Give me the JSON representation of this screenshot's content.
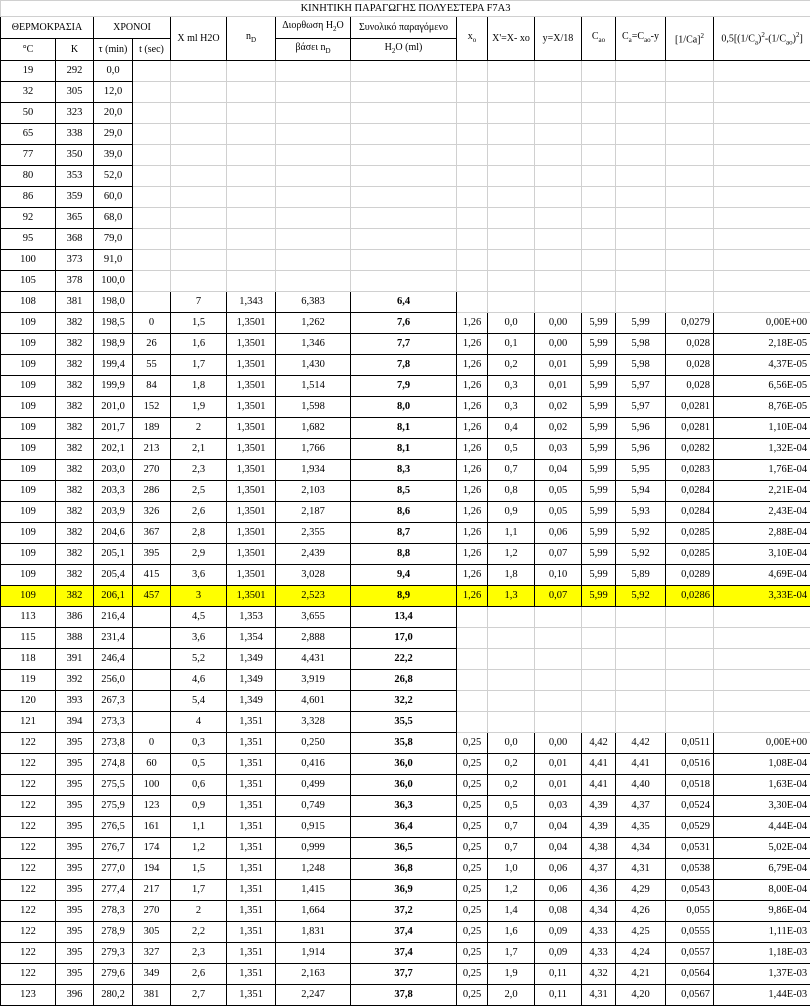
{
  "title": "ΚΙΝΗΤΙΚΗ ΠΑΡΑΓΩΓΗΣ ΠΟΛΥΕΣΤΕΡΑ F7A3",
  "header": {
    "temperature_group": "ΘΕΡΜΟΚΡΑΣΙΑ",
    "times_group": "ΧΡΟΝΟΙ",
    "celsius": "°C",
    "kelvin": "K",
    "t_min": "τ (min)",
    "t_sec": "t (sec)",
    "x_ml": "X ml H2O",
    "nd": "nD",
    "correction": "Διορθωση H2O βάσει nD",
    "total": "Συνολικό παραγόμενο H2O (ml)",
    "xo": "xo",
    "xprime": "X'=X- xo",
    "y": "y=X/18",
    "cao": "Cao",
    "ca": "Ca=Cao-y",
    "inv_ca2": "[1/Ca]²",
    "half_formula": "0,5[(1/Ca)²-(1/Cao)²]"
  },
  "rows": [
    [
      "19",
      "292",
      "0,0",
      "",
      "",
      "",
      "",
      "",
      "",
      "",
      "",
      "",
      "",
      "",
      ""
    ],
    [
      "32",
      "305",
      "12,0",
      "",
      "",
      "",
      "",
      "",
      "",
      "",
      "",
      "",
      "",
      "",
      ""
    ],
    [
      "50",
      "323",
      "20,0",
      "",
      "",
      "",
      "",
      "",
      "",
      "",
      "",
      "",
      "",
      "",
      ""
    ],
    [
      "65",
      "338",
      "29,0",
      "",
      "",
      "",
      "",
      "",
      "",
      "",
      "",
      "",
      "",
      "",
      ""
    ],
    [
      "77",
      "350",
      "39,0",
      "",
      "",
      "",
      "",
      "",
      "",
      "",
      "",
      "",
      "",
      "",
      ""
    ],
    [
      "80",
      "353",
      "52,0",
      "",
      "",
      "",
      "",
      "",
      "",
      "",
      "",
      "",
      "",
      "",
      ""
    ],
    [
      "86",
      "359",
      "60,0",
      "",
      "",
      "",
      "",
      "",
      "",
      "",
      "",
      "",
      "",
      "",
      ""
    ],
    [
      "92",
      "365",
      "68,0",
      "",
      "",
      "",
      "",
      "",
      "",
      "",
      "",
      "",
      "",
      "",
      ""
    ],
    [
      "95",
      "368",
      "79,0",
      "",
      "",
      "",
      "",
      "",
      "",
      "",
      "",
      "",
      "",
      "",
      ""
    ],
    [
      "100",
      "373",
      "91,0",
      "",
      "",
      "",
      "",
      "",
      "",
      "",
      "",
      "",
      "",
      "",
      ""
    ],
    [
      "105",
      "378",
      "100,0",
      "",
      "",
      "",
      "",
      "",
      "",
      "",
      "",
      "",
      "",
      "",
      ""
    ],
    [
      "108",
      "381",
      "198,0",
      "",
      "7",
      "1,343",
      "6,383",
      "6,4",
      "",
      "",
      "",
      "",
      "",
      "",
      ""
    ],
    [
      "109",
      "382",
      "198,5",
      "0",
      "1,5",
      "1,3501",
      "1,262",
      "7,6",
      "1,26",
      "0,0",
      "0,00",
      "5,99",
      "5,99",
      "0,0279",
      "0,00E+00"
    ],
    [
      "109",
      "382",
      "198,9",
      "26",
      "1,6",
      "1,3501",
      "1,346",
      "7,7",
      "1,26",
      "0,1",
      "0,00",
      "5,99",
      "5,98",
      "0,028",
      "2,18E-05"
    ],
    [
      "109",
      "382",
      "199,4",
      "55",
      "1,7",
      "1,3501",
      "1,430",
      "7,8",
      "1,26",
      "0,2",
      "0,01",
      "5,99",
      "5,98",
      "0,028",
      "4,37E-05"
    ],
    [
      "109",
      "382",
      "199,9",
      "84",
      "1,8",
      "1,3501",
      "1,514",
      "7,9",
      "1,26",
      "0,3",
      "0,01",
      "5,99",
      "5,97",
      "0,028",
      "6,56E-05"
    ],
    [
      "109",
      "382",
      "201,0",
      "152",
      "1,9",
      "1,3501",
      "1,598",
      "8,0",
      "1,26",
      "0,3",
      "0,02",
      "5,99",
      "5,97",
      "0,0281",
      "8,76E-05"
    ],
    [
      "109",
      "382",
      "201,7",
      "189",
      "2",
      "1,3501",
      "1,682",
      "8,1",
      "1,26",
      "0,4",
      "0,02",
      "5,99",
      "5,96",
      "0,0281",
      "1,10E-04"
    ],
    [
      "109",
      "382",
      "202,1",
      "213",
      "2,1",
      "1,3501",
      "1,766",
      "8,1",
      "1,26",
      "0,5",
      "0,03",
      "5,99",
      "5,96",
      "0,0282",
      "1,32E-04"
    ],
    [
      "109",
      "382",
      "203,0",
      "270",
      "2,3",
      "1,3501",
      "1,934",
      "8,3",
      "1,26",
      "0,7",
      "0,04",
      "5,99",
      "5,95",
      "0,0283",
      "1,76E-04"
    ],
    [
      "109",
      "382",
      "203,3",
      "286",
      "2,5",
      "1,3501",
      "2,103",
      "8,5",
      "1,26",
      "0,8",
      "0,05",
      "5,99",
      "5,94",
      "0,0284",
      "2,21E-04"
    ],
    [
      "109",
      "382",
      "203,9",
      "326",
      "2,6",
      "1,3501",
      "2,187",
      "8,6",
      "1,26",
      "0,9",
      "0,05",
      "5,99",
      "5,93",
      "0,0284",
      "2,43E-04"
    ],
    [
      "109",
      "382",
      "204,6",
      "367",
      "2,8",
      "1,3501",
      "2,355",
      "8,7",
      "1,26",
      "1,1",
      "0,06",
      "5,99",
      "5,92",
      "0,0285",
      "2,88E-04"
    ],
    [
      "109",
      "382",
      "205,1",
      "395",
      "2,9",
      "1,3501",
      "2,439",
      "8,8",
      "1,26",
      "1,2",
      "0,07",
      "5,99",
      "5,92",
      "0,0285",
      "3,10E-04"
    ],
    [
      "109",
      "382",
      "205,4",
      "415",
      "3,6",
      "1,3501",
      "3,028",
      "9,4",
      "1,26",
      "1,8",
      "0,10",
      "5,99",
      "5,89",
      "0,0289",
      "4,69E-04"
    ],
    [
      "109",
      "382",
      "206,1",
      "457",
      "3",
      "1,3501",
      "2,523",
      "8,9",
      "1,26",
      "1,3",
      "0,07",
      "5,99",
      "5,92",
      "0,0286",
      "3,33E-04"
    ],
    [
      "113",
      "386",
      "216,4",
      "",
      "4,5",
      "1,353",
      "3,655",
      "13,4",
      "",
      "",
      "",
      "",
      "",
      "",
      ""
    ],
    [
      "115",
      "388",
      "231,4",
      "",
      "3,6",
      "1,354",
      "2,888",
      "17,0",
      "",
      "",
      "",
      "",
      "",
      "",
      ""
    ],
    [
      "118",
      "391",
      "246,4",
      "",
      "5,2",
      "1,349",
      "4,431",
      "22,2",
      "",
      "",
      "",
      "",
      "",
      "",
      ""
    ],
    [
      "119",
      "392",
      "256,0",
      "",
      "4,6",
      "1,349",
      "3,919",
      "26,8",
      "",
      "",
      "",
      "",
      "",
      "",
      ""
    ],
    [
      "120",
      "393",
      "267,3",
      "",
      "5,4",
      "1,349",
      "4,601",
      "32,2",
      "",
      "",
      "",
      "",
      "",
      "",
      ""
    ],
    [
      "121",
      "394",
      "273,3",
      "",
      "4",
      "1,351",
      "3,328",
      "35,5",
      "",
      "",
      "",
      "",
      "",
      "",
      ""
    ],
    [
      "122",
      "395",
      "273,8",
      "0",
      "0,3",
      "1,351",
      "0,250",
      "35,8",
      "0,25",
      "0,0",
      "0,00",
      "4,42",
      "4,42",
      "0,0511",
      "0,00E+00"
    ],
    [
      "122",
      "395",
      "274,8",
      "60",
      "0,5",
      "1,351",
      "0,416",
      "36,0",
      "0,25",
      "0,2",
      "0,01",
      "4,41",
      "4,41",
      "0,0516",
      "1,08E-04"
    ],
    [
      "122",
      "395",
      "275,5",
      "100",
      "0,6",
      "1,351",
      "0,499",
      "36,0",
      "0,25",
      "0,2",
      "0,01",
      "4,41",
      "4,40",
      "0,0518",
      "1,63E-04"
    ],
    [
      "122",
      "395",
      "275,9",
      "123",
      "0,9",
      "1,351",
      "0,749",
      "36,3",
      "0,25",
      "0,5",
      "0,03",
      "4,39",
      "4,37",
      "0,0524",
      "3,30E-04"
    ],
    [
      "122",
      "395",
      "276,5",
      "161",
      "1,1",
      "1,351",
      "0,915",
      "36,4",
      "0,25",
      "0,7",
      "0,04",
      "4,39",
      "4,35",
      "0,0529",
      "4,44E-04"
    ],
    [
      "122",
      "395",
      "276,7",
      "174",
      "1,2",
      "1,351",
      "0,999",
      "36,5",
      "0,25",
      "0,7",
      "0,04",
      "4,38",
      "4,34",
      "0,0531",
      "5,02E-04"
    ],
    [
      "122",
      "395",
      "277,0",
      "194",
      "1,5",
      "1,351",
      "1,248",
      "36,8",
      "0,25",
      "1,0",
      "0,06",
      "4,37",
      "4,31",
      "0,0538",
      "6,79E-04"
    ],
    [
      "122",
      "395",
      "277,4",
      "217",
      "1,7",
      "1,351",
      "1,415",
      "36,9",
      "0,25",
      "1,2",
      "0,06",
      "4,36",
      "4,29",
      "0,0543",
      "8,00E-04"
    ],
    [
      "122",
      "395",
      "278,3",
      "270",
      "2",
      "1,351",
      "1,664",
      "37,2",
      "0,25",
      "1,4",
      "0,08",
      "4,34",
      "4,26",
      "0,055",
      "9,86E-04"
    ],
    [
      "122",
      "395",
      "278,9",
      "305",
      "2,2",
      "1,351",
      "1,831",
      "37,4",
      "0,25",
      "1,6",
      "0,09",
      "4,33",
      "4,25",
      "0,0555",
      "1,11E-03"
    ],
    [
      "122",
      "395",
      "279,3",
      "327",
      "2,3",
      "1,351",
      "1,914",
      "37,4",
      "0,25",
      "1,7",
      "0,09",
      "4,33",
      "4,24",
      "0,0557",
      "1,18E-03"
    ],
    [
      "122",
      "395",
      "279,6",
      "349",
      "2,6",
      "1,351",
      "2,163",
      "37,7",
      "0,25",
      "1,9",
      "0,11",
      "4,32",
      "4,21",
      "0,0564",
      "1,37E-03"
    ],
    [
      "123",
      "396",
      "280,2",
      "381",
      "2,7",
      "1,351",
      "2,247",
      "37,8",
      "0,25",
      "2,0",
      "0,11",
      "4,31",
      "4,20",
      "0,0567",
      "1,44E-03"
    ]
  ],
  "highlight_row_index": 25,
  "highlight_color": "#ffff00"
}
